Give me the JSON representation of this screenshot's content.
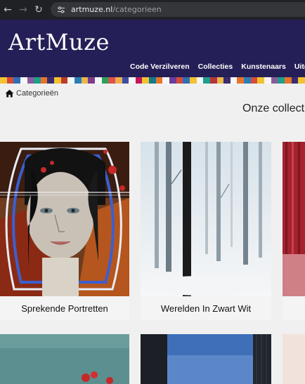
{
  "browser": {
    "url_domain": "artmuze.nl",
    "url_path": "/categorieen"
  },
  "site": {
    "logo": "ArtMuze",
    "nav": [
      "Code Verzilveren",
      "Collecties",
      "Kunstenaars",
      "Uitge"
    ]
  },
  "breadcrumb": {
    "label": "Categorieën"
  },
  "section_title": "Onze collectie",
  "categories": [
    {
      "label": "Sprekende Portretten"
    },
    {
      "label": "Werelden In Zwart Wit"
    }
  ],
  "colors": {
    "header_bg": "#241f56",
    "stripe_colors": [
      "#f2c230",
      "#d94a3a",
      "#2f6fb5",
      "#f7f7f7",
      "#8a5c9e",
      "#1e9e8c",
      "#e8732c",
      "#3b2c6e",
      "#f2c230",
      "#c0392b",
      "#f7f7f7",
      "#2a7fba",
      "#e9b84a",
      "#7a3e8c",
      "#f7f7f7",
      "#2f9e5b",
      "#d9534f",
      "#f0ad4e",
      "#3b4fa0",
      "#f7f7f7",
      "#c2185b",
      "#f2c230",
      "#0f7b8a",
      "#e8732c",
      "#f7f7f7",
      "#6a3d9a",
      "#d94a3a",
      "#2f6fb5",
      "#f2c230",
      "#f7f7f7",
      "#1e9e8c",
      "#b8323c",
      "#e9b84a",
      "#3b2c6e",
      "#f7f7f7",
      "#e8732c",
      "#2a7fba",
      "#d94a3a",
      "#f2c230",
      "#f7f7f7",
      "#8a5c9e",
      "#1e9e8c",
      "#e8732c",
      "#3b2c6e",
      "#f2c230"
    ]
  }
}
